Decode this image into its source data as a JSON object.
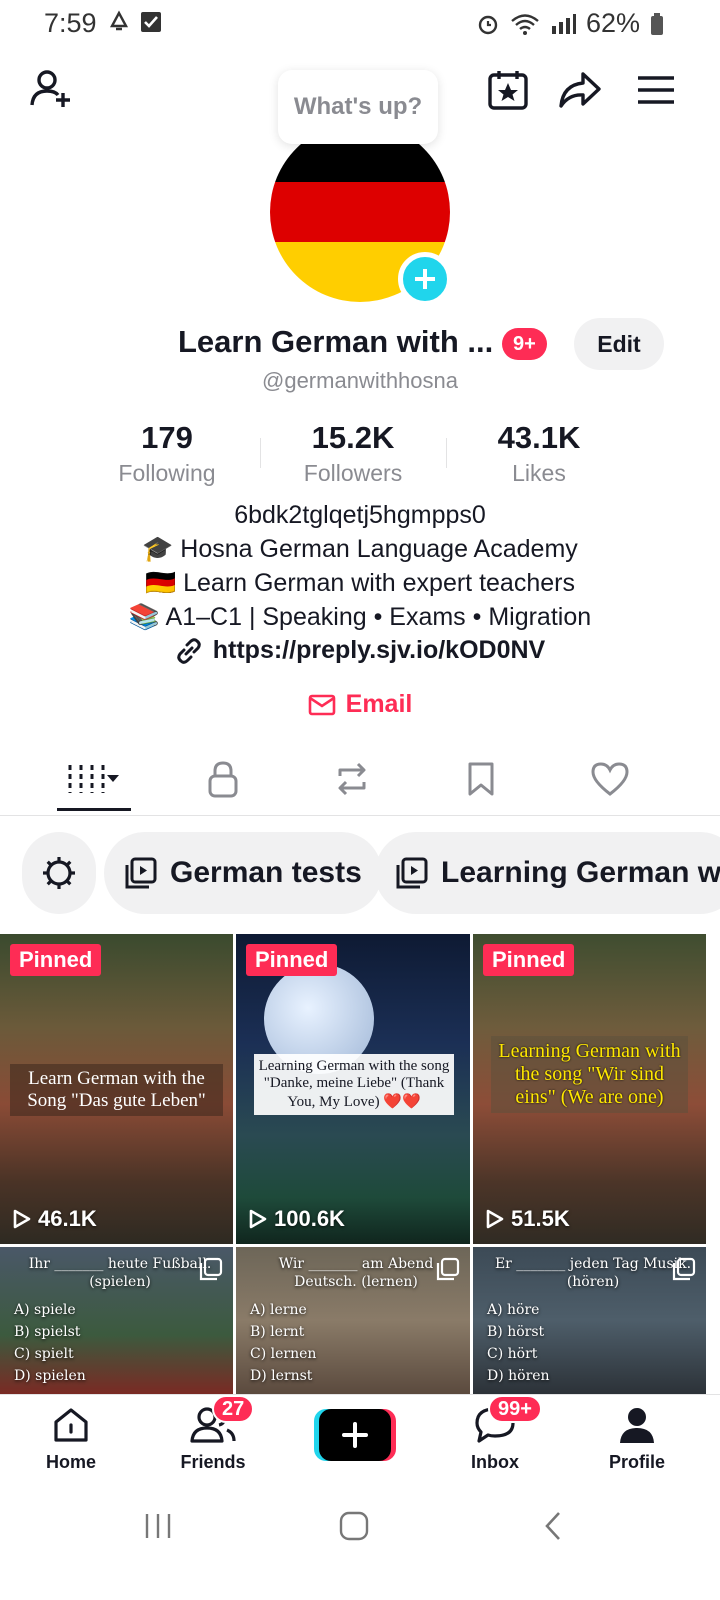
{
  "status_bar": {
    "time": "7:59",
    "battery": "62%"
  },
  "header": {
    "bubble": "What's up?"
  },
  "profile": {
    "name": "Learn German with ...",
    "notif_badge": "9+",
    "edit_label": "Edit",
    "handle": "@germanwithhosna",
    "stats": [
      {
        "value": "179",
        "label": "Following"
      },
      {
        "value": "15.2K",
        "label": "Followers"
      },
      {
        "value": "43.1K",
        "label": "Likes"
      }
    ],
    "bio": [
      "6bdk2tglqetj5hgmpps0",
      "🎓 Hosna German Language Academy",
      "🇩🇪 Learn German with expert teachers",
      "📚 A1–C1 | Speaking • Exams • Migration"
    ],
    "link": "https://preply.sjv.io/kOD0NV",
    "email_label": "Email"
  },
  "playlists": [
    {
      "label": "German tests"
    },
    {
      "label": "Learning German w"
    }
  ],
  "videos": [
    {
      "pinned": "Pinned",
      "text": "Learn German with the Song \"Das gute Leben\"",
      "views": "46.1K"
    },
    {
      "pinned": "Pinned",
      "text": "Learning German with the song \"Danke, meine Liebe\" (Thank You, My Love) ❤️❤️",
      "views": "100.6K"
    },
    {
      "pinned": "Pinned",
      "text": "Learning German with the song \"Wir sind eins\" (We are one)",
      "views": "51.5K"
    }
  ],
  "quiz_videos": [
    {
      "question": "Ihr _______ heute Fußball. (spielen)",
      "options": [
        "A) spiele",
        "B) spielst",
        "C) spielt",
        "D) spielen"
      ]
    },
    {
      "question": "Wir _______ am Abend Deutsch. (lernen)",
      "options": [
        "A) lerne",
        "B) lernt",
        "C) lernen",
        "D) lernst"
      ]
    },
    {
      "question": "Er _______ jeden Tag Musik. (hören)",
      "options": [
        "A) höre",
        "B) hörst",
        "C) hört",
        "D) hören"
      ]
    }
  ],
  "bottom_nav": {
    "home": "Home",
    "friends": "Friends",
    "friends_badge": "27",
    "inbox": "Inbox",
    "inbox_badge": "99+",
    "profile": "Profile"
  },
  "colors": {
    "accent": "#fe2c55",
    "cyan": "#20d5ec",
    "muted": "#8a8b91"
  }
}
